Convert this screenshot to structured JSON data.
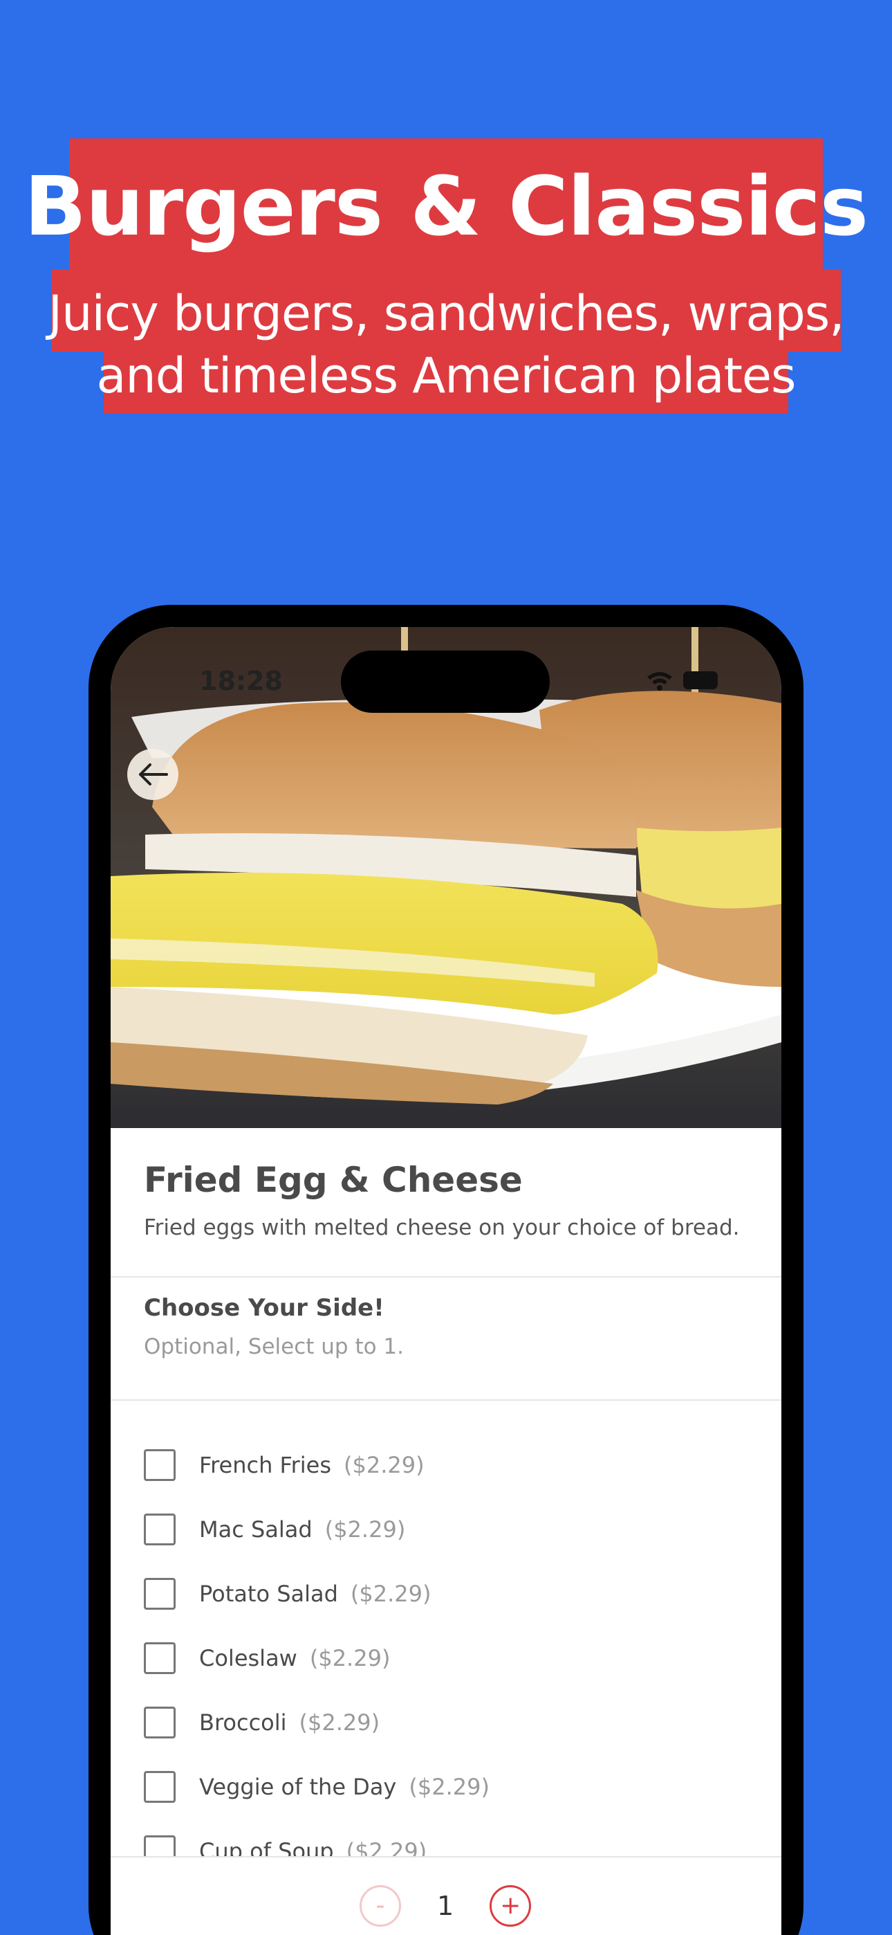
{
  "banner": {
    "title": "Burgers & Classics",
    "subtitle_line1": "Juicy burgers, sandwiches, wraps,",
    "subtitle_line2": "and timeless American plates"
  },
  "status_bar": {
    "time": "18:28"
  },
  "item": {
    "title": "Fried Egg & Cheese",
    "description": "Fried eggs with melted cheese on your choice of bread."
  },
  "side_section": {
    "title": "Choose Your Side!",
    "subtitle": "Optional, Select up to 1.",
    "options": [
      {
        "label": "French Fries",
        "price": "($2.29)"
      },
      {
        "label": "Mac Salad",
        "price": "($2.29)"
      },
      {
        "label": "Potato Salad",
        "price": "($2.29)"
      },
      {
        "label": "Coleslaw",
        "price": "($2.29)"
      },
      {
        "label": "Broccoli",
        "price": "($2.29)"
      },
      {
        "label": "Veggie of the Day",
        "price": "($2.29)"
      },
      {
        "label": "Cup of Soup",
        "price": "($2.29)"
      }
    ]
  },
  "quantity": {
    "minus": "-",
    "value": "1",
    "plus": "+"
  },
  "colors": {
    "background": "#2D6EEA",
    "accent": "#DD3B40"
  }
}
